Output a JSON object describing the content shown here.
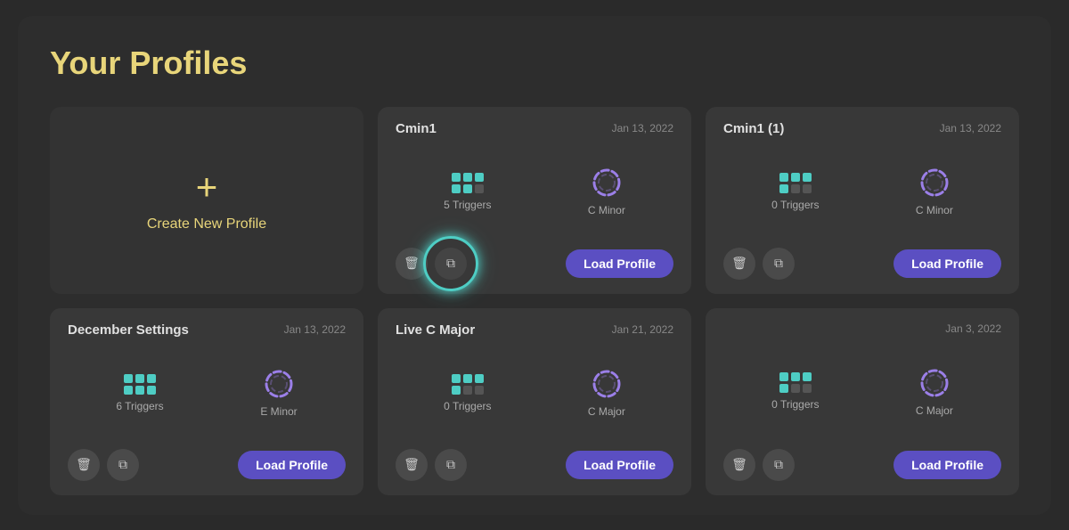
{
  "page": {
    "title": "Your Profiles"
  },
  "cards": [
    {
      "id": "create-new",
      "type": "create",
      "label": "Create New Profile",
      "plus": "+"
    },
    {
      "id": "cmin1",
      "type": "profile",
      "name": "Cmin1",
      "date": "Jan 13, 2022",
      "triggers": 5,
      "triggers_label": "5 Triggers",
      "key": "C Minor",
      "active_cells": [
        0,
        1,
        2,
        3,
        4
      ],
      "total_cells": 6,
      "load_label": "Load Profile",
      "highlighted_copy": true
    },
    {
      "id": "cmin1-1",
      "type": "profile",
      "name": "Cmin1 (1)",
      "date": "Jan 13, 2022",
      "triggers": 0,
      "triggers_label": "0 Triggers",
      "key": "C Minor",
      "active_cells": [
        0,
        1,
        2,
        3
      ],
      "total_cells": 6,
      "load_label": "Load Profile",
      "highlighted_copy": false
    },
    {
      "id": "december-settings",
      "type": "profile",
      "name": "December Settings",
      "date": "Jan 13, 2022",
      "triggers": 6,
      "triggers_label": "6 Triggers",
      "key": "E Minor",
      "active_cells": [
        0,
        1,
        2,
        3,
        4,
        5
      ],
      "total_cells": 6,
      "load_label": "Load Profile",
      "highlighted_copy": false
    },
    {
      "id": "live-c-major",
      "type": "profile",
      "name": "Live C Major",
      "date": "Jan 21, 2022",
      "triggers": 0,
      "triggers_label": "0 Triggers",
      "key": "C Major",
      "active_cells": [
        0,
        1,
        2,
        3
      ],
      "total_cells": 6,
      "load_label": "Load Profile",
      "highlighted_copy": false
    },
    {
      "id": "untitled",
      "type": "profile",
      "name": "",
      "date": "Jan 3, 2022",
      "triggers": 0,
      "triggers_label": "0 Triggers",
      "key": "C Major",
      "active_cells": [
        0,
        1,
        2,
        3
      ],
      "total_cells": 6,
      "load_label": "Load Profile",
      "highlighted_copy": false
    }
  ],
  "icons": {
    "delete": "🗑",
    "copy": "⧉",
    "trigger_active_color": "#4ecdc4",
    "trigger_inactive_color": "#555555",
    "key_colors": [
      "#9b7fe8",
      "#b89aee",
      "#c4aaee",
      "#8b6ad4",
      "#7a5abf",
      "#6b4aaf"
    ]
  }
}
